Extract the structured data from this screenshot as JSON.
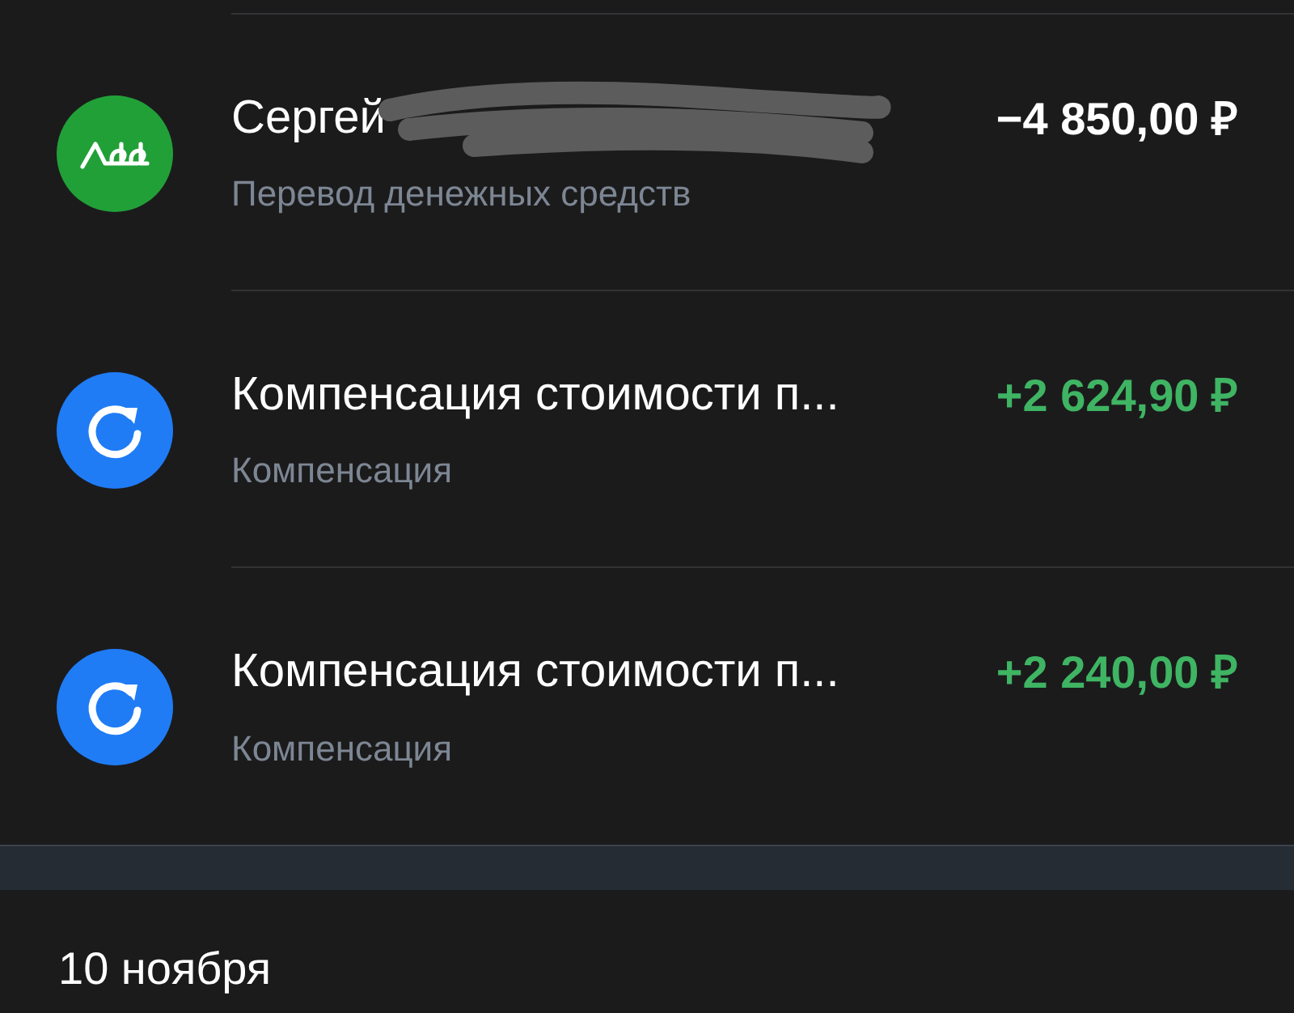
{
  "transactions": [
    {
      "kind": "transfer",
      "redacted": true,
      "title": "Сергей",
      "subtitle": "Перевод денежных средств",
      "amount": "−4 850,00 ₽",
      "income": false
    },
    {
      "kind": "compensation",
      "redacted": false,
      "title": "Компенсация стоимости п...",
      "subtitle": "Компенсация",
      "amount": "+2 624,90 ₽",
      "income": true
    },
    {
      "kind": "compensation",
      "redacted": false,
      "title": "Компенсация стоимости п...",
      "subtitle": "Компенсация",
      "amount": "+2 240,00 ₽",
      "income": true
    }
  ],
  "next_date": "10 ноября"
}
